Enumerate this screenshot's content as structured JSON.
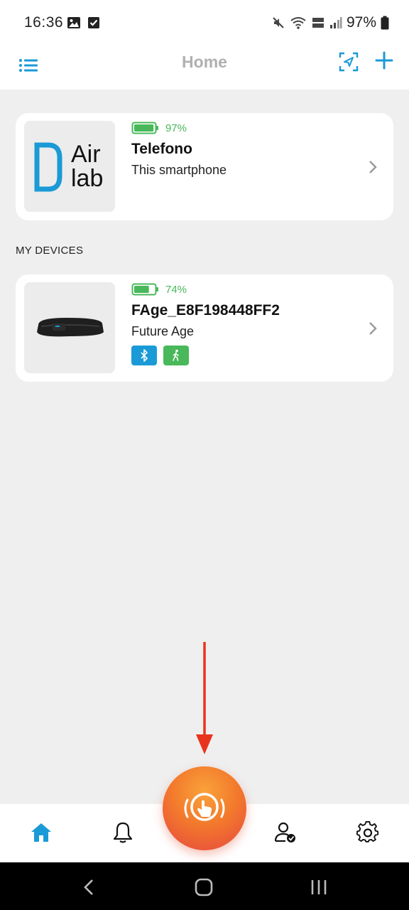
{
  "status_bar": {
    "time": "16:36",
    "battery": "97%"
  },
  "header": {
    "title": "Home"
  },
  "phone_card": {
    "logo_text_top": "Air",
    "logo_text_bottom": "lab",
    "battery_percent": "97%",
    "battery_level": 0.97,
    "name": "Telefono",
    "subtitle": "This smartphone"
  },
  "my_devices": {
    "section_label": "MY DEVICES",
    "devices": [
      {
        "battery_percent": "74%",
        "battery_level": 0.74,
        "name": "FAge_E8F198448FF2",
        "subtitle": "Future Age",
        "badges": [
          "bluetooth-icon",
          "walking-icon"
        ]
      }
    ]
  },
  "bottom_nav": {
    "items": [
      "home-icon",
      "bell-icon",
      "sos-touch-icon",
      "user-check-icon",
      "gear-icon"
    ],
    "active": "home-icon"
  },
  "colors": {
    "accent": "#1a9ad6",
    "battery_green": "#48b85a",
    "bluetooth_badge": "#1a9ad6",
    "walk_badge": "#48b85a",
    "arrow": "#e8341c",
    "sos_orange": "#f37a2c",
    "sos_red": "#e6473f"
  }
}
